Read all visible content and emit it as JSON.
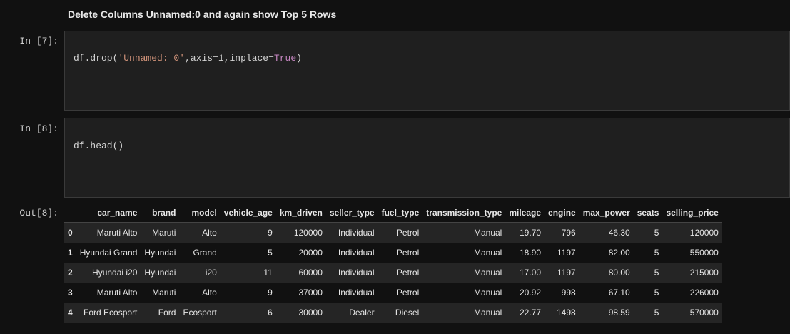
{
  "markdown_heading": "Delete Columns Unnamed:0 and again show Top 5 Rows",
  "cells": [
    {
      "prompt": "In [7]:",
      "code": {
        "prefix": "df.drop(",
        "string": "'Unnamed: 0'",
        "mid1": ",axis",
        "eq1": "=",
        "num": "1",
        "mid2": ",inplace",
        "eq2": "=",
        "kw": "True",
        "suffix": ")"
      }
    },
    {
      "prompt": "In [8]:",
      "code_text": "df.head()"
    }
  ],
  "output": {
    "prompt": "Out[8]:",
    "columns": [
      "",
      "car_name",
      "brand",
      "model",
      "vehicle_age",
      "km_driven",
      "seller_type",
      "fuel_type",
      "transmission_type",
      "mileage",
      "engine",
      "max_power",
      "seats",
      "selling_price"
    ],
    "rows": [
      [
        "0",
        "Maruti Alto",
        "Maruti",
        "Alto",
        "9",
        "120000",
        "Individual",
        "Petrol",
        "Manual",
        "19.70",
        "796",
        "46.30",
        "5",
        "120000"
      ],
      [
        "1",
        "Hyundai Grand",
        "Hyundai",
        "Grand",
        "5",
        "20000",
        "Individual",
        "Petrol",
        "Manual",
        "18.90",
        "1197",
        "82.00",
        "5",
        "550000"
      ],
      [
        "2",
        "Hyundai i20",
        "Hyundai",
        "i20",
        "11",
        "60000",
        "Individual",
        "Petrol",
        "Manual",
        "17.00",
        "1197",
        "80.00",
        "5",
        "215000"
      ],
      [
        "3",
        "Maruti Alto",
        "Maruti",
        "Alto",
        "9",
        "37000",
        "Individual",
        "Petrol",
        "Manual",
        "20.92",
        "998",
        "67.10",
        "5",
        "226000"
      ],
      [
        "4",
        "Ford Ecosport",
        "Ford",
        "Ecosport",
        "6",
        "30000",
        "Dealer",
        "Diesel",
        "Manual",
        "22.77",
        "1498",
        "98.59",
        "5",
        "570000"
      ]
    ]
  }
}
